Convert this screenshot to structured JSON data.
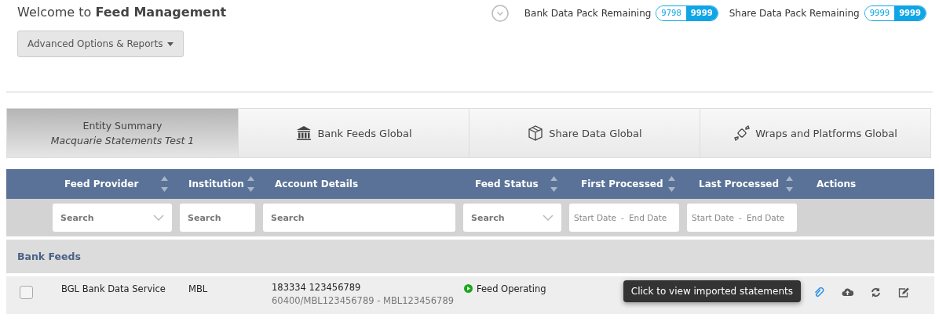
{
  "header": {
    "title_prefix": "Welcome to",
    "title_bold": "Feed Management",
    "options_button": "Advanced Options & Reports"
  },
  "packs": [
    {
      "label": "Bank Data Pack Remaining",
      "remaining": "9798",
      "total": "9999"
    },
    {
      "label": "Share Data Pack Remaining",
      "remaining": "9999",
      "total": "9999"
    }
  ],
  "tabs": [
    {
      "kind": "entity",
      "label": "Entity Summary",
      "subtitle": "Macquarie Statements Test 1",
      "selected": true
    },
    {
      "kind": "bank",
      "label": "Bank Feeds Global",
      "selected": false
    },
    {
      "kind": "share",
      "label": "Share Data Global",
      "selected": false
    },
    {
      "kind": "wraps",
      "label": "Wraps and Platforms Global",
      "selected": false
    }
  ],
  "table": {
    "columns": [
      {
        "label": "Feed Provider",
        "sortable": true
      },
      {
        "label": "Institution",
        "sortable": true
      },
      {
        "label": "Account Details",
        "sortable": false
      },
      {
        "label": "Feed Status",
        "sortable": true
      },
      {
        "label": "First Processed",
        "sortable": true
      },
      {
        "label": "Last Processed",
        "sortable": true
      },
      {
        "label": "Actions",
        "sortable": false
      }
    ],
    "filters": [
      {
        "kind": "select",
        "placeholder": "Search"
      },
      {
        "kind": "text",
        "placeholder": "Search"
      },
      {
        "kind": "text",
        "placeholder": "Search"
      },
      {
        "kind": "select",
        "placeholder": "Search"
      },
      {
        "kind": "daterange",
        "start": "Start Date",
        "sep": "-",
        "end": "End Date"
      },
      {
        "kind": "daterange",
        "start": "Start Date",
        "sep": "-",
        "end": "End Date"
      }
    ],
    "group": "Bank Feeds",
    "rows": [
      {
        "checked": false,
        "provider": "BGL Bank Data Service",
        "institution": "MBL",
        "account": "183334 123456789",
        "account_sub": "60400/MBL123456789 - MBL123456789",
        "status": "Feed Operating",
        "color": "#1aa81a",
        "actions": [
          {
            "kind": "clip",
            "active": true
          },
          {
            "kind": "upload",
            "active": false
          },
          {
            "kind": "refresh",
            "active": false
          },
          {
            "kind": "edit",
            "active": false
          }
        ],
        "tooltip": "Click to view imported statements"
      }
    ]
  }
}
